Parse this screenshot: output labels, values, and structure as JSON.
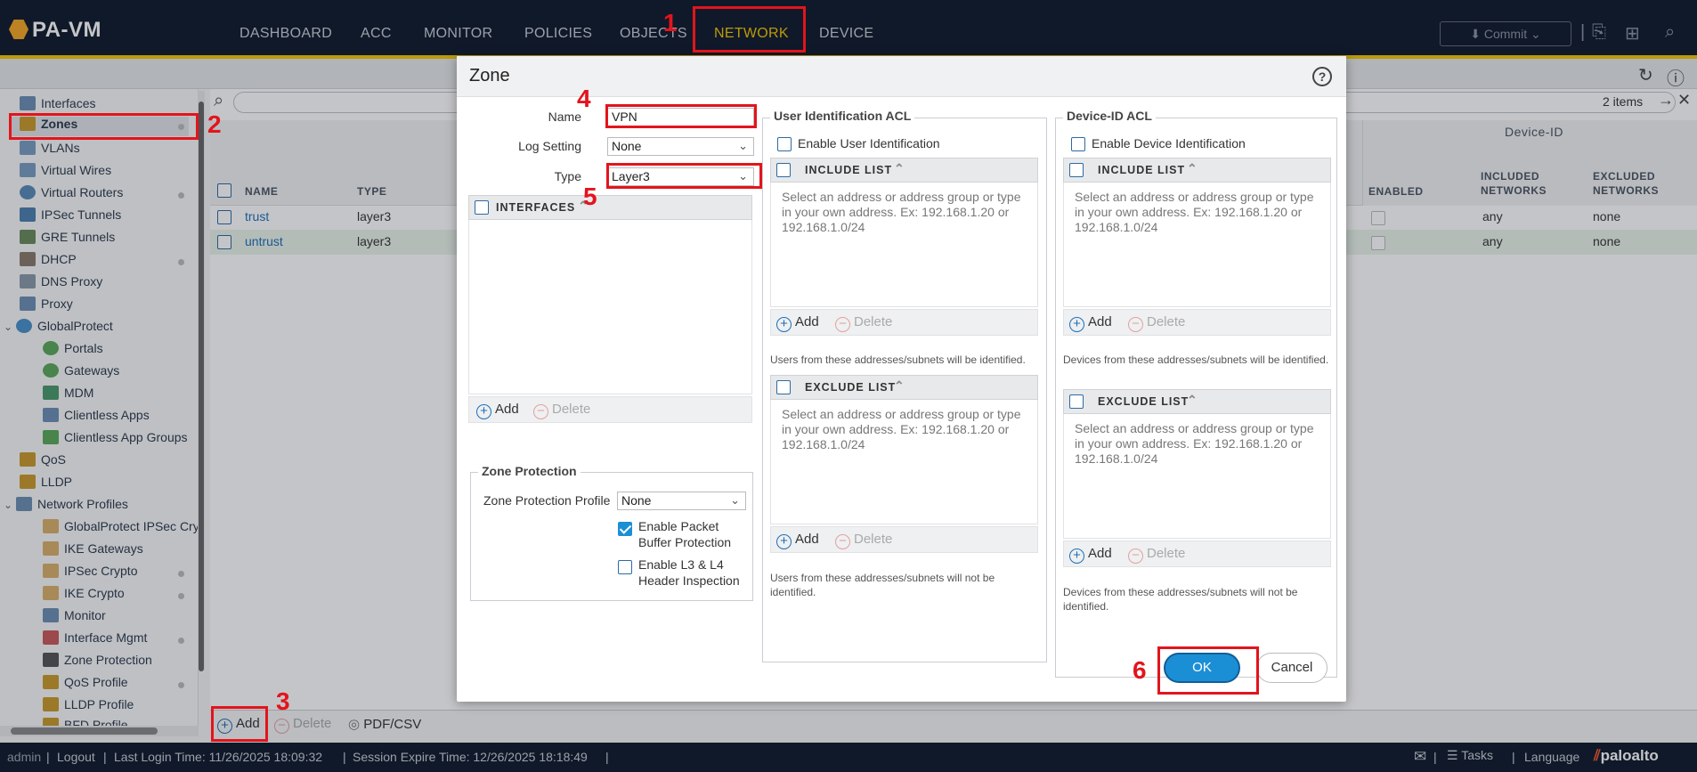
{
  "app": {
    "logo": "PA-VM"
  },
  "nav": {
    "tabs": [
      "DASHBOARD",
      "ACC",
      "MONITOR",
      "POLICIES",
      "OBJECTS",
      "NETWORK",
      "DEVICE"
    ],
    "commit_label": "Commit"
  },
  "annotations": [
    "1",
    "2",
    "3",
    "4",
    "5",
    "6"
  ],
  "sidebar": {
    "items": [
      "Interfaces",
      "Zones",
      "VLANs",
      "Virtual Wires",
      "Virtual Routers",
      "IPSec Tunnels",
      "GRE Tunnels",
      "DHCP",
      "DNS Proxy",
      "Proxy",
      "GlobalProtect",
      "Portals",
      "Gateways",
      "MDM",
      "Clientless Apps",
      "Clientless App Groups",
      "QoS",
      "LLDP",
      "Network Profiles",
      "GlobalProtect IPSec Cry",
      "IKE Gateways",
      "IPSec Crypto",
      "IKE Crypto",
      "Monitor",
      "Interface Mgmt",
      "Zone Protection",
      "QoS Profile",
      "LLDP Profile",
      "BFD Profile"
    ]
  },
  "table": {
    "items_count": "2 items",
    "group_header": "Device-ID",
    "columns": [
      "NAME",
      "TYPE",
      "ENABLED",
      "INCLUDED NETWORKS",
      "EXCLUDED NETWORKS"
    ],
    "rows": [
      {
        "name": "trust",
        "type": "layer3",
        "included": "any",
        "excluded": "none"
      },
      {
        "name": "untrust",
        "type": "layer3",
        "included": "any",
        "excluded": "none"
      }
    ]
  },
  "toolbar": {
    "add": "Add",
    "delete": "Delete",
    "pdf": "PDF/CSV"
  },
  "status": {
    "user": "admin",
    "logout": "Logout",
    "last_login": "Last Login Time: 11/26/2025 18:09:32",
    "session_expire": "Session Expire Time: 12/26/2025 18:18:49",
    "tasks": "Tasks",
    "language": "Language",
    "brand": "paloalto"
  },
  "dialog": {
    "title": "Zone",
    "name_label": "Name",
    "name_value": "VPN",
    "log_label": "Log Setting",
    "log_value": "None",
    "type_label": "Type",
    "type_value": "Layer3",
    "interfaces_header": "INTERFACES",
    "add": "Add",
    "delete": "Delete",
    "zone_protection": {
      "title": "Zone Protection",
      "profile_label": "Zone Protection Profile",
      "profile_value": "None",
      "packet_buffer_label": "Enable Packet Buffer Protection",
      "packet_buffer_checked": true,
      "l3l4_label": "Enable L3 & L4 Header Inspection",
      "l3l4_checked": false
    },
    "user_acl": {
      "title": "User Identification ACL",
      "enable_label": "Enable User Identification",
      "include_header": "INCLUDE LIST",
      "exclude_header": "EXCLUDE LIST",
      "placeholder": "Select an address or address group or type in your own address. Ex: 192.168.1.20 or 192.168.1.0/24",
      "include_note": "Users from these addresses/subnets will be identified.",
      "exclude_note": "Users from these addresses/subnets will not be identified."
    },
    "device_acl": {
      "title": "Device-ID ACL",
      "enable_label": "Enable Device Identification",
      "include_header": "INCLUDE LIST",
      "exclude_header": "EXCLUDE LIST",
      "placeholder": "Select an address or address group or type in your own address. Ex: 192.168.1.20 or 192.168.1.0/24",
      "include_note": "Devices from these addresses/subnets will be identified.",
      "exclude_note": "Devices from these addresses/subnets will not be identified."
    },
    "ok": "OK",
    "cancel": "Cancel"
  },
  "colors": {
    "accent": "#f5c500",
    "nav_bg": "#0f1a2b",
    "primary": "#1b8fd6",
    "annotation": "#e3141c"
  }
}
